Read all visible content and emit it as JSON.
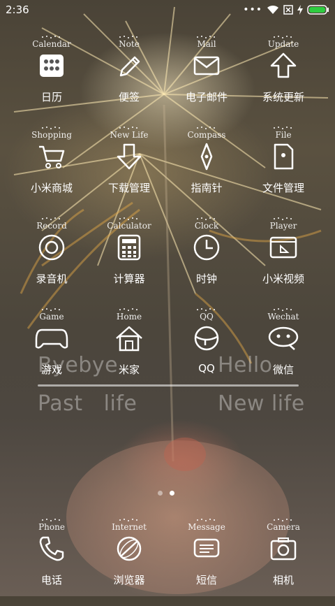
{
  "status_bar": {
    "time": "2:36",
    "battery_color": "#2ecc40"
  },
  "rows": [
    [
      {
        "tag": "Calendar",
        "label": "日历",
        "icon": "calendar-icon"
      },
      {
        "tag": "Note",
        "label": "便签",
        "icon": "pencil-icon"
      },
      {
        "tag": "Mail",
        "label": "电子邮件",
        "icon": "mail-icon"
      },
      {
        "tag": "Update",
        "label": "系统更新",
        "icon": "update-icon"
      }
    ],
    [
      {
        "tag": "Shopping",
        "label": "小米商城",
        "icon": "cart-icon"
      },
      {
        "tag": "New Life",
        "label": "下载管理",
        "icon": "download-icon"
      },
      {
        "tag": "Compass",
        "label": "指南针",
        "icon": "compass-icon"
      },
      {
        "tag": "File",
        "label": "文件管理",
        "icon": "file-icon"
      }
    ],
    [
      {
        "tag": "Record",
        "label": "录音机",
        "icon": "record-icon"
      },
      {
        "tag": "Calculator",
        "label": "计算器",
        "icon": "calculator-icon"
      },
      {
        "tag": "Clock",
        "label": "时钟",
        "icon": "clock-icon"
      },
      {
        "tag": "Player",
        "label": "小米视频",
        "icon": "player-icon"
      }
    ],
    [
      {
        "tag": "Game",
        "label": "游戏",
        "icon": "gamepad-icon"
      },
      {
        "tag": "Home",
        "label": "米家",
        "icon": "home-icon"
      },
      {
        "tag": "QQ",
        "label": "QQ",
        "icon": "qq-icon"
      },
      {
        "tag": "Wechat",
        "label": "微信",
        "icon": "wechat-icon"
      }
    ]
  ],
  "widget": {
    "left_top": "Byebye",
    "right_top": "Hello",
    "left_bottom": "Past   life",
    "right_bottom": "New life"
  },
  "pager": {
    "pages": 2,
    "active": 1
  },
  "dock": [
    {
      "tag": "Phone",
      "label": "电话",
      "icon": "phone-icon"
    },
    {
      "tag": "Internet",
      "label": "浏览器",
      "icon": "browser-icon"
    },
    {
      "tag": "Message",
      "label": "短信",
      "icon": "message-icon"
    },
    {
      "tag": "Camera",
      "label": "相机",
      "icon": "camera-icon"
    }
  ]
}
